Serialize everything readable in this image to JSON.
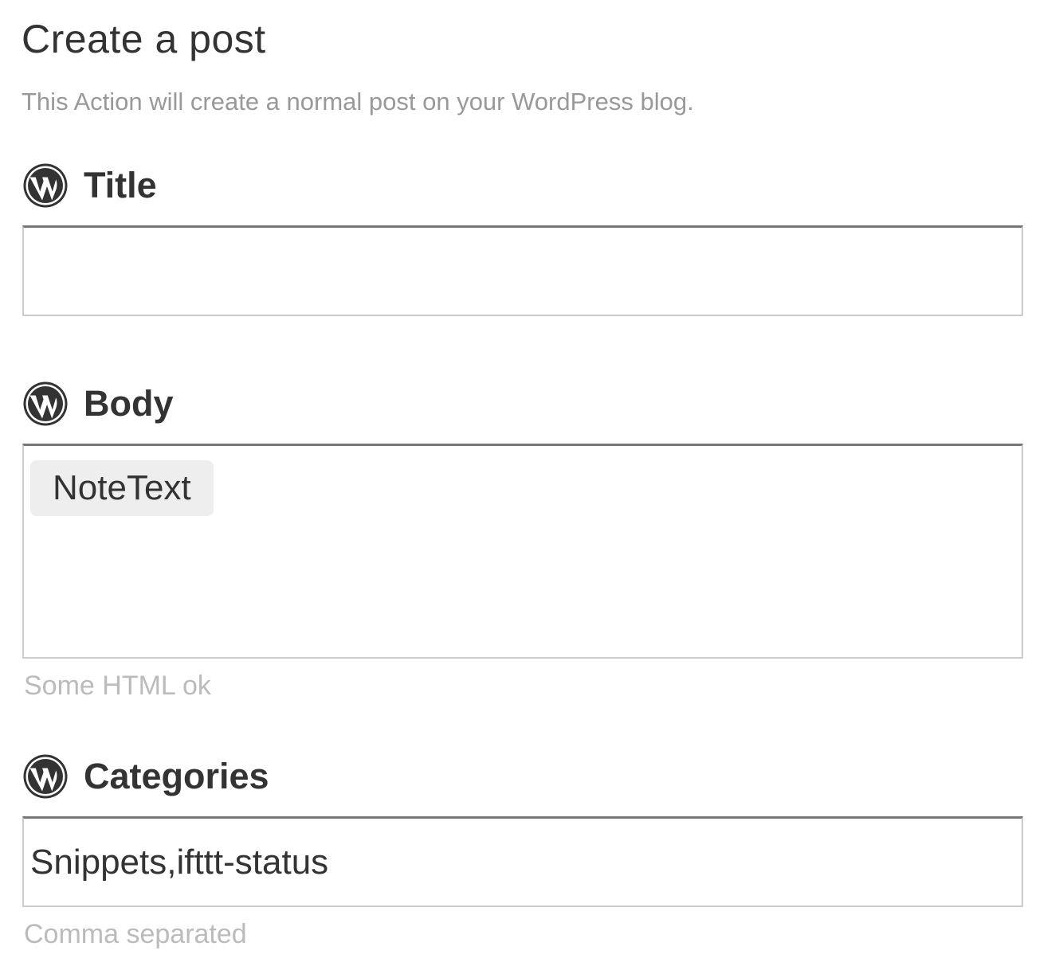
{
  "page": {
    "title": "Create a post",
    "description": "This Action will create a normal post on your WordPress blog."
  },
  "icons": {
    "field_icon": "wordpress-logo-icon",
    "color": "#333333"
  },
  "fields": {
    "title": {
      "label": "Title",
      "value": ""
    },
    "body": {
      "label": "Body",
      "ingredient": "NoteText",
      "helper": "Some HTML ok"
    },
    "categories": {
      "label": "Categories",
      "value": "Snippets,ifttt-status",
      "helper": "Comma separated"
    }
  }
}
